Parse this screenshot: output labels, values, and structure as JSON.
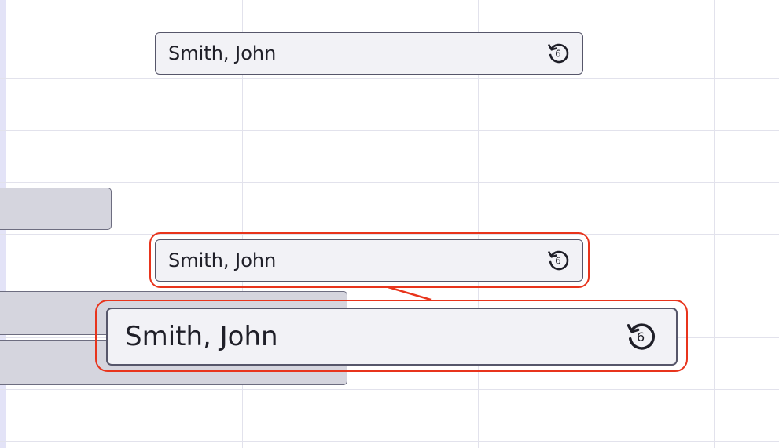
{
  "events": {
    "top": {
      "name": "Smith, John",
      "recurrence_count": "6",
      "icon": "repeat-history-icon"
    },
    "middle": {
      "name": "Smith, John",
      "recurrence_count": "6",
      "icon": "repeat-history-icon"
    },
    "zoom": {
      "name": "Smith, John",
      "recurrence_count": "6",
      "icon": "repeat-history-icon"
    }
  },
  "colors": {
    "highlight": "#e8341c",
    "event_bg": "#f2f2f6",
    "event_border": "#56566a",
    "bar_bg": "#d5d5de",
    "grid": "#e2e2ec"
  }
}
